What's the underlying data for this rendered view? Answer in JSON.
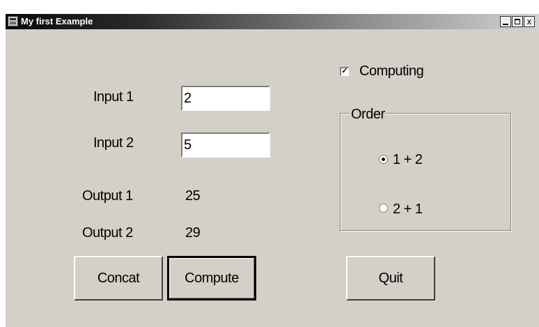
{
  "window": {
    "title": "My first Example",
    "min_icon": "_",
    "max_icon": "",
    "close_icon": "x"
  },
  "form": {
    "input1_label": "Input 1",
    "input1_value": "2",
    "input2_label": "Input 2",
    "input2_value": "5",
    "output1_label": "Output 1",
    "output1_value": "25",
    "output2_label": "Output 2",
    "output2_value": "29",
    "computing_label": "Computing",
    "computing_checked": true,
    "checkmark": "✓",
    "order_label": "Order",
    "order_options": [
      {
        "label": "1 + 2",
        "checked": true
      },
      {
        "label": "2 + 1",
        "checked": false
      }
    ]
  },
  "buttons": {
    "concat": "Concat",
    "compute": "Compute",
    "quit": "Quit"
  }
}
